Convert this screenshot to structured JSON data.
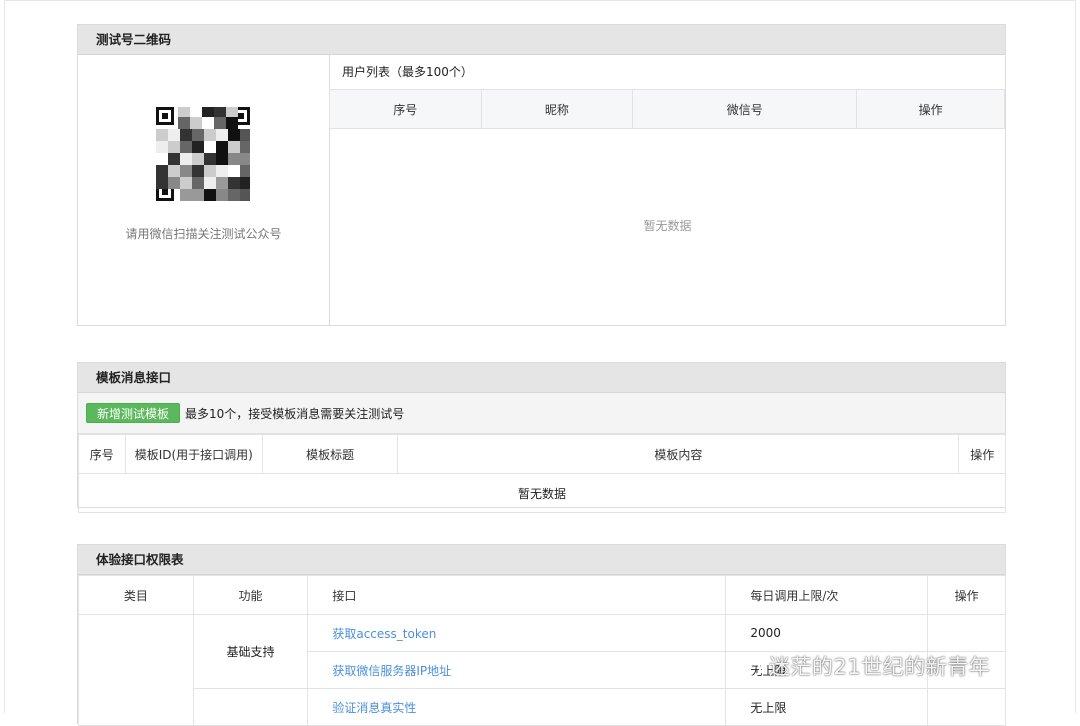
{
  "qr_panel": {
    "title": "测试号二维码",
    "caption": "请用微信扫描关注测试公众号",
    "users_title": "用户列表（最多100个）",
    "columns": [
      "序号",
      "昵称",
      "微信号",
      "操作"
    ],
    "empty_text": "暂无数据"
  },
  "template_panel": {
    "title": "模板消息接口",
    "add_button": "新增测试模板",
    "note": "最多10个，接受模板消息需要关注测试号",
    "columns": [
      "序号",
      "模板ID(用于接口调用)",
      "模板标题",
      "模板内容",
      "操作"
    ],
    "empty_text": "暂无数据"
  },
  "permission_panel": {
    "title": "体验接口权限表",
    "columns": [
      "类目",
      "功能",
      "接口",
      "每日调用上限/次",
      "操作"
    ],
    "rows": [
      {
        "function": "基础支持",
        "api": "获取access_token",
        "limit": "2000"
      },
      {
        "function": "",
        "api": "获取微信服务器IP地址",
        "limit": "无上限"
      },
      {
        "function": "",
        "api": "验证消息真实性",
        "limit": "无上限"
      }
    ]
  },
  "watermark": {
    "text": "迷茫的21世纪的新青年",
    "icon": "wechat-icon"
  }
}
